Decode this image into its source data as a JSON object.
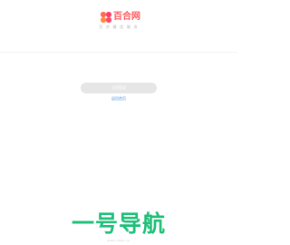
{
  "brand": {
    "logo_icon": "flower-logo-icon",
    "name": "百合网",
    "tagline": "百 合 婚 恋 服 务"
  },
  "main": {
    "action_label": "立即登录",
    "link_label": "返回首页"
  },
  "footer": {
    "brand_name": "一号导航",
    "note": "www.1hao.cn"
  },
  "colors": {
    "brand_red": "#ff5a5f",
    "button_bg": "#e6e6e6",
    "link_blue": "#4a90e2",
    "footer_green": "#1fbf7a"
  }
}
